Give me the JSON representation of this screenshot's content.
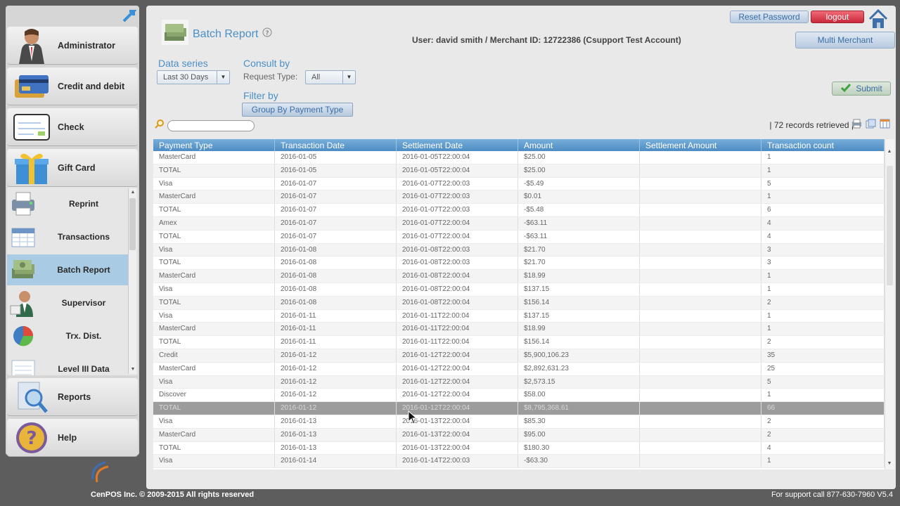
{
  "sidebar": {
    "main_items": [
      {
        "label": "Administrator",
        "icon": "administrator-icon"
      },
      {
        "label": "Credit and debit",
        "icon": "credit-cards-icon"
      },
      {
        "label": "Check",
        "icon": "check-icon"
      },
      {
        "label": "Gift Card",
        "icon": "gift-card-icon"
      }
    ],
    "sub_items": [
      {
        "label": "Reprint",
        "icon": "printer-icon"
      },
      {
        "label": "Transactions",
        "icon": "calendar-icon"
      },
      {
        "label": "Batch Report",
        "icon": "money-stack-icon"
      },
      {
        "label": "Supervisor",
        "icon": "supervisor-icon"
      },
      {
        "label": "Trx. Dist.",
        "icon": "pie-chart-icon"
      },
      {
        "label": "Level III Data",
        "icon": "document-icon"
      }
    ],
    "bottom_items": [
      {
        "label": "Reports",
        "icon": "magnifier-icon"
      },
      {
        "label": "Help",
        "icon": "help-icon"
      }
    ]
  },
  "header": {
    "title": "Batch Report",
    "user_info": "User: david smith  / Merchant ID: 12722386 (Csupport Test Account)",
    "reset_password": "Reset Password",
    "logout": "logout",
    "multi_merchant": "Multi Merchant"
  },
  "filters": {
    "data_series_label": "Data series",
    "data_series_value": "Last 30 Days",
    "consult_by_label": "Consult by",
    "request_type_label": "Request Type:",
    "request_type_value": "All",
    "filter_by_label": "Filter by",
    "group_button": "Group By Payment Type",
    "submit": "Submit"
  },
  "records": "| 72 records retrieved |",
  "table": {
    "columns": [
      "Payment Type",
      "Transaction Date",
      "Settlement Date",
      "Amount",
      "Settlement Amount",
      "Transaction count"
    ],
    "rows": [
      [
        "MasterCard",
        "2016-01-05",
        "2016-01-05T22:00:04",
        "$25.00",
        "",
        "1"
      ],
      [
        "TOTAL",
        "2016-01-05",
        "2016-01-05T22:00:04",
        "$25.00",
        "",
        "1"
      ],
      [
        "Visa",
        "2016-01-07",
        "2016-01-07T22:00:03",
        "-$5.49",
        "",
        "5"
      ],
      [
        "MasterCard",
        "2016-01-07",
        "2016-01-07T22:00:03",
        "$0.01",
        "",
        "1"
      ],
      [
        "TOTAL",
        "2016-01-07",
        "2016-01-07T22:00:03",
        "-$5.48",
        "",
        "6"
      ],
      [
        "Amex",
        "2016-01-07",
        "2016-01-07T22:00:04",
        "-$63.11",
        "",
        "4"
      ],
      [
        "TOTAL",
        "2016-01-07",
        "2016-01-07T22:00:04",
        "-$63.11",
        "",
        "4"
      ],
      [
        "Visa",
        "2016-01-08",
        "2016-01-08T22:00:03",
        "$21.70",
        "",
        "3"
      ],
      [
        "TOTAL",
        "2016-01-08",
        "2016-01-08T22:00:03",
        "$21.70",
        "",
        "3"
      ],
      [
        "MasterCard",
        "2016-01-08",
        "2016-01-08T22:00:04",
        "$18.99",
        "",
        "1"
      ],
      [
        "Visa",
        "2016-01-08",
        "2016-01-08T22:00:04",
        "$137.15",
        "",
        "1"
      ],
      [
        "TOTAL",
        "2016-01-08",
        "2016-01-08T22:00:04",
        "$156.14",
        "",
        "2"
      ],
      [
        "Visa",
        "2016-01-11",
        "2016-01-11T22:00:04",
        "$137.15",
        "",
        "1"
      ],
      [
        "MasterCard",
        "2016-01-11",
        "2016-01-11T22:00:04",
        "$18.99",
        "",
        "1"
      ],
      [
        "TOTAL",
        "2016-01-11",
        "2016-01-11T22:00:04",
        "$156.14",
        "",
        "2"
      ],
      [
        "Credit",
        "2016-01-12",
        "2016-01-12T22:00:04",
        "$5,900,106.23",
        "",
        "35"
      ],
      [
        "MasterCard",
        "2016-01-12",
        "2016-01-12T22:00:04",
        "$2,892,631.23",
        "",
        "25"
      ],
      [
        "Visa",
        "2016-01-12",
        "2016-01-12T22:00:04",
        "$2,573.15",
        "",
        "5"
      ],
      [
        "Discover",
        "2016-01-12",
        "2016-01-12T22:00:04",
        "$58.00",
        "",
        "1"
      ],
      [
        "TOTAL",
        "2016-01-12",
        "2016-01-12T22:00:04",
        "$8,795,368.61",
        "",
        "66"
      ],
      [
        "Visa",
        "2016-01-13",
        "2016-01-13T22:00:04",
        "$85.30",
        "",
        "2"
      ],
      [
        "MasterCard",
        "2016-01-13",
        "2016-01-13T22:00:04",
        "$95.00",
        "",
        "2"
      ],
      [
        "TOTAL",
        "2016-01-13",
        "2016-01-13T22:00:04",
        "$180.30",
        "",
        "4"
      ],
      [
        "Visa",
        "2016-01-14",
        "2016-01-14T22:00:03",
        "-$63.30",
        "",
        "1"
      ]
    ],
    "selected_row": 19
  },
  "footer": {
    "copyright": "CenPOS Inc. © 2009-2015 All rights reserved",
    "support": "For support call 877-630-7960  V5.4"
  }
}
